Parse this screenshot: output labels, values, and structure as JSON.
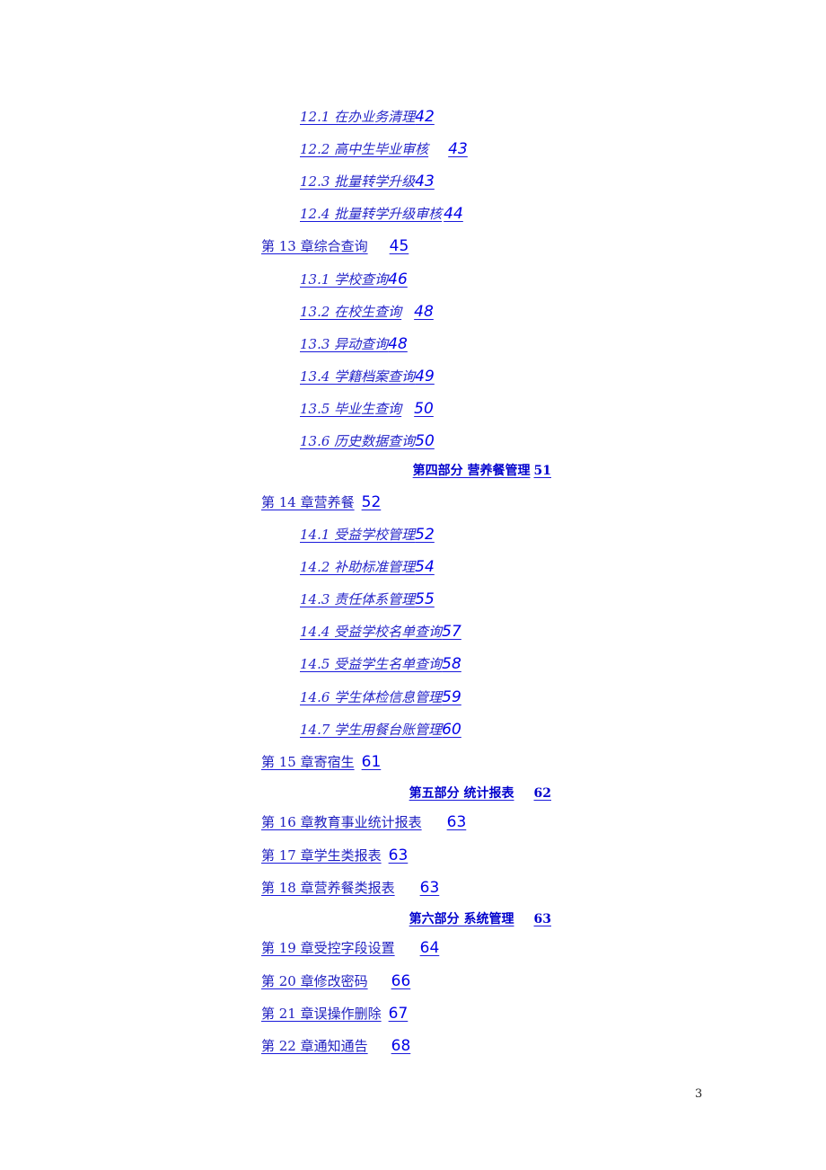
{
  "toc": {
    "entries": [
      {
        "level": "section",
        "title": "12.1  在办业务清理",
        "gap": 0,
        "page": "42"
      },
      {
        "level": "section",
        "title": "12.2  高中生毕业审核",
        "gap": 22,
        "page": "43"
      },
      {
        "level": "section",
        "title": "12.3  批量转学升级",
        "gap": 0,
        "page": "43"
      },
      {
        "level": "section",
        "title": "12.4  批量转学升级审核",
        "gap": 2,
        "page": "44"
      },
      {
        "level": "chapter",
        "title": "第 13 章综合查询",
        "gap": 24,
        "page": "45"
      },
      {
        "level": "section",
        "title": "13.1  学校查询",
        "gap": 0,
        "page": "46"
      },
      {
        "level": "section",
        "title": "13.2  在校生查询",
        "gap": 14,
        "page": "48"
      },
      {
        "level": "section",
        "title": "13.3  异动查询",
        "gap": 0,
        "page": "48"
      },
      {
        "level": "section",
        "title": "13.4  学籍档案查询",
        "gap": 0,
        "page": "49"
      },
      {
        "level": "section",
        "title": "13.5  毕业生查询",
        "gap": 14,
        "page": "50"
      },
      {
        "level": "section",
        "title": "13.6  历史数据查询",
        "gap": 0,
        "page": "50"
      },
      {
        "level": "part",
        "title": "第四部分  营养餐管理",
        "gap": 4,
        "page": "51"
      },
      {
        "level": "chapter",
        "title": "第 14 章营养餐",
        "gap": 8,
        "page": "52"
      },
      {
        "level": "section",
        "title": "14.1  受益学校管理",
        "gap": 0,
        "page": "52"
      },
      {
        "level": "section",
        "title": "14.2  补助标准管理",
        "gap": 0,
        "page": "54"
      },
      {
        "level": "section",
        "title": "14.3  责任体系管理",
        "gap": 0,
        "page": "55"
      },
      {
        "level": "section",
        "title": "14.4  受益学校名单查询",
        "gap": 0,
        "page": "57"
      },
      {
        "level": "section",
        "title": "14.5  受益学生名单查询",
        "gap": 0,
        "page": "58"
      },
      {
        "level": "section",
        "title": "14.6  学生体检信息管理",
        "gap": 0,
        "page": "59"
      },
      {
        "level": "section",
        "title": "14.7  学生用餐台账管理",
        "gap": 0,
        "page": "60"
      },
      {
        "level": "chapter",
        "title": "第 15 章寄宿生",
        "gap": 8,
        "page": "61"
      },
      {
        "level": "part",
        "title": "第五部分  统计报表",
        "gap": 22,
        "page": "62"
      },
      {
        "level": "chapter",
        "title": "第 16 章教育事业统计报表",
        "gap": 28,
        "page": "63"
      },
      {
        "level": "chapter",
        "title": "第 17 章学生类报表",
        "gap": 8,
        "page": "63"
      },
      {
        "level": "chapter",
        "title": "第 18 章营养餐类报表",
        "gap": 28,
        "page": "63"
      },
      {
        "level": "part",
        "title": "第六部分  系统管理",
        "gap": 22,
        "page": "63"
      },
      {
        "level": "chapter",
        "title": "第 19 章受控字段设置",
        "gap": 28,
        "page": "64"
      },
      {
        "level": "chapter",
        "title": "第 20 章修改密码",
        "gap": 26,
        "page": "66"
      },
      {
        "level": "chapter",
        "title": "第 21 章误操作删除",
        "gap": 8,
        "page": "67"
      },
      {
        "level": "chapter",
        "title": "第 22 章通知通告",
        "gap": 26,
        "page": "68"
      }
    ]
  },
  "footer": {
    "page_number": "3"
  },
  "colors": {
    "link": "#1a1adb",
    "link_number": "#0000e6"
  }
}
